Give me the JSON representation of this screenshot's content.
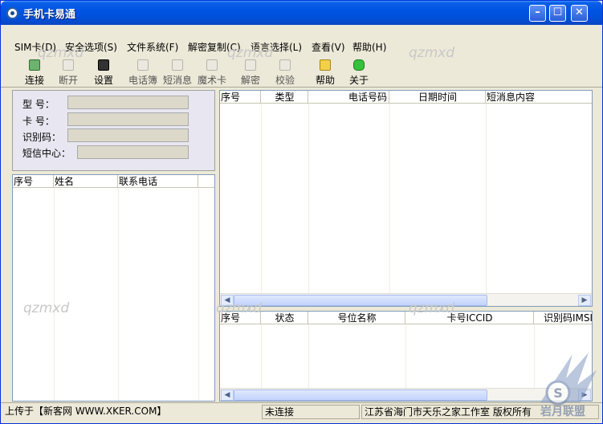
{
  "window": {
    "title": "手机卡易通"
  },
  "menu": [
    "SIM卡(D)",
    "安全选项(S)",
    "文件系统(F)",
    "解密复制(C)",
    "语言选择(L)",
    "查看(V)",
    "帮助(H)"
  ],
  "toolbar": [
    {
      "label": "连接",
      "icon": "connect-icon"
    },
    {
      "label": "断开",
      "icon": "disconnect-icon"
    },
    {
      "label": "设置",
      "icon": "printer-settings-icon"
    },
    {
      "label": "电话簿",
      "icon": "phonebook-icon"
    },
    {
      "label": "短消息",
      "icon": "sms-icon"
    },
    {
      "label": "魔术卡",
      "icon": "magic-card-icon"
    },
    {
      "label": "解密",
      "icon": "funnel-decrypt-icon"
    },
    {
      "label": "校验",
      "icon": "verify-icon"
    },
    {
      "label": "帮助",
      "icon": "help-icon"
    },
    {
      "label": "关于",
      "icon": "about-hand-icon"
    }
  ],
  "info": {
    "model_label": "型  号：",
    "card_label": "卡  号：",
    "id_label": "识别码：",
    "sms_center_label": "短信中心："
  },
  "contacts": {
    "columns": [
      "序号",
      "姓名",
      "联系电话"
    ]
  },
  "messages": {
    "columns": [
      "序号",
      "类型",
      "电话号码",
      "日期时间",
      "短消息内容"
    ]
  },
  "cards": {
    "columns": [
      "序号",
      "状态",
      "号位名称",
      "卡号ICCID",
      "识别码IMSI"
    ]
  },
  "status": {
    "upload": "上传于【新客网 WWW.XKER.COM】",
    "connection": "未连接",
    "copyright": "江苏省海门市天乐之家工作室 版权所有"
  },
  "watermark": "qzmxd",
  "logo": {
    "text": "岩月联盟"
  }
}
